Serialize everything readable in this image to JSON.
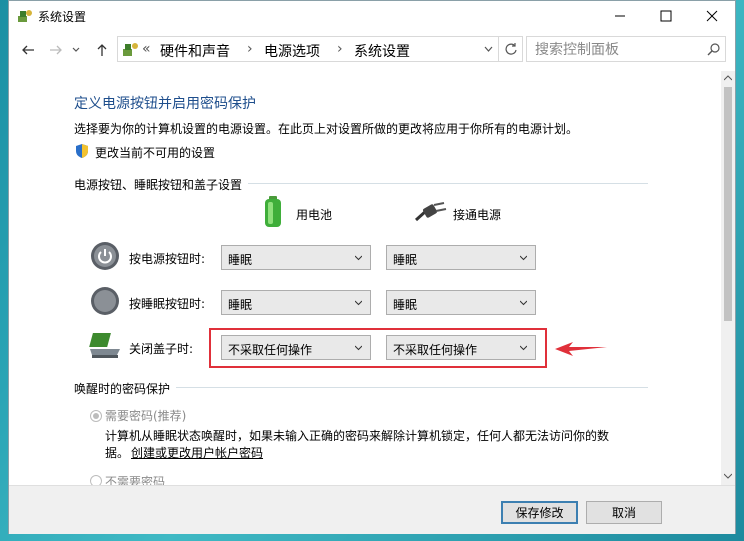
{
  "window": {
    "title": "系统设置"
  },
  "address": {
    "overflow": "«",
    "crumbs": [
      "硬件和声音",
      "电源选项",
      "系统设置"
    ]
  },
  "search": {
    "placeholder": "搜索控制面板"
  },
  "page": {
    "heading": "定义电源按钮并启用密码保护",
    "description": "选择要为你的计算机设置的电源设置。在此页上对设置所做的更改将应用于你所有的电源计划。",
    "change_link": "更改当前不可用的设置",
    "section_buttons": "电源按钮、睡眠按钮和盖子设置",
    "col_battery": "用电池",
    "col_plugged": "接通电源",
    "rows": [
      {
        "label": "按电源按钮时:",
        "battery": "睡眠",
        "plugged": "睡眠"
      },
      {
        "label": "按睡眠按钮时:",
        "battery": "睡眠",
        "plugged": "睡眠"
      },
      {
        "label": "关闭盖子时:",
        "battery": "不采取任何操作",
        "plugged": "不采取任何操作"
      }
    ],
    "section_password": "唤醒时的密码保护",
    "require_password": "需要密码(推荐)",
    "require_desc_1": "计算机从睡眠状态唤醒时，如果未输入正确的密码来解除计算机锁定，任何人都无法访问你的数",
    "require_desc_2": "据。",
    "account_link": "创建或更改用户帐户密码",
    "no_password": "不需要密码"
  },
  "footer": {
    "save": "保存修改",
    "cancel": "取消"
  },
  "colors": {
    "highlight": "#e0303a",
    "heading": "#1e4e8c",
    "link": "#0066cc"
  }
}
